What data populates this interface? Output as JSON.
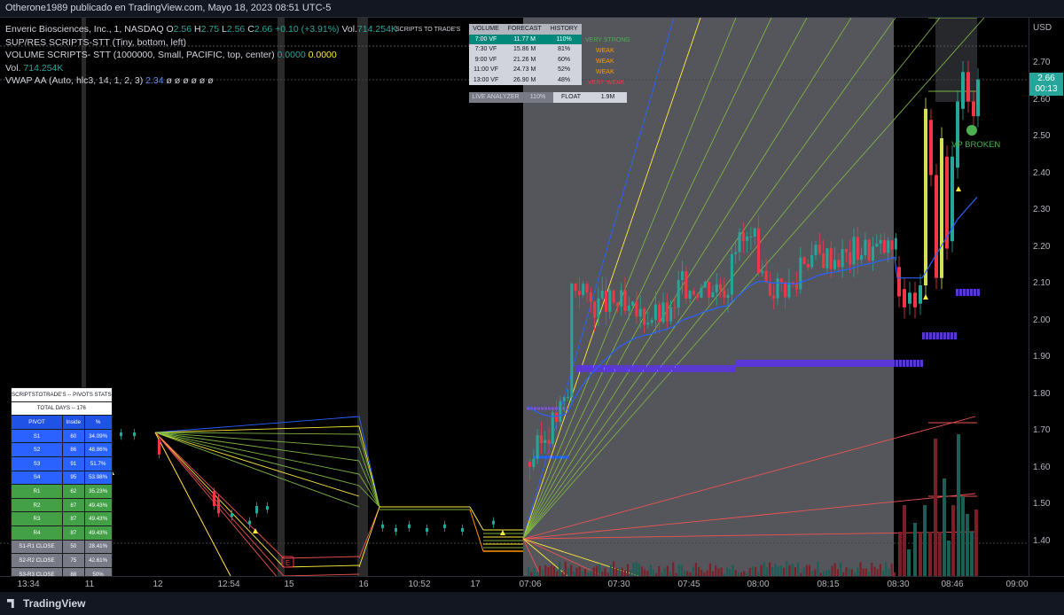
{
  "header": {
    "published": "Otherone1989 publicado en TradingView.com, Mayo 18, 2023 08:51 UTC-5"
  },
  "legend": {
    "symbol_line": "Enveric Biosciences, Inc., 1, NASDAQ",
    "o_label": "O",
    "o": "2.56",
    "h_label": "H",
    "h": "2.75",
    "l_label": "L",
    "l": "2.56",
    "c_label": "C",
    "c": "2.66",
    "change": "+0.10 (+3.91%)",
    "vol_label": "Vol.",
    "vol": "714.254K",
    "sup_res": "SUP/RES SCRIPTS-STT (Tiny, bottom, left)",
    "vol_scripts": "VOLUME SCRIPTS- STT (1000000, Small, PACIFIC, top, center)",
    "vol_scripts_v1": "0.0000",
    "vol_scripts_v2": "0.0000",
    "vol2_label": "Vol.",
    "vol2": "714.254K",
    "vwap": "VWAP AA (Auto, hlc3, 14, 1, 2, 3)",
    "vwap_value": "2.34",
    "vwap_rest": "ø ø ø ø ø ø"
  },
  "volume_table": {
    "title": "SCRIPTS TO TRADE'S",
    "headers": [
      "VOLUME",
      "FORECAST",
      "HISTORY"
    ],
    "rows": [
      {
        "time": "7:00 VF",
        "forecast": "11.77 M",
        "history": "110%",
        "status": "VERY STRONG",
        "status_color": "#4caf50",
        "highlight": true
      },
      {
        "time": "7:30 VF",
        "forecast": "15.86 M",
        "history": "81%",
        "status": "WEAK",
        "status_color": "#ff9800",
        "highlight": false
      },
      {
        "time": "9:00 VF",
        "forecast": "21.26 M",
        "history": "60%",
        "status": "WEAK",
        "status_color": "#ff9800",
        "highlight": false
      },
      {
        "time": "11:00 VF",
        "forecast": "24.73 M",
        "history": "52%",
        "status": "WEAK",
        "status_color": "#ff9800",
        "highlight": false
      },
      {
        "time": "13:00 VF",
        "forecast": "26.90 M",
        "history": "48%",
        "status": "VERY WEAK",
        "status_color": "#f23645",
        "highlight": false
      }
    ],
    "live_label": "LIVE ANALYZER",
    "live_value": "110%",
    "float_label": "FLOAT",
    "float_value": "1.9M"
  },
  "pivot_table": {
    "title": "SCRIPTSTOTRADE'S -- PIVOTS STATS",
    "total_days": "TOTAL DAYS -- 176",
    "headers": [
      "PIVOT",
      "Inside",
      "%"
    ],
    "rows": [
      {
        "pivot": "S1",
        "inside": "60",
        "pct": "34.09%",
        "color": "#2962ff"
      },
      {
        "pivot": "S2",
        "inside": "86",
        "pct": "48.86%",
        "color": "#2962ff"
      },
      {
        "pivot": "S3",
        "inside": "91",
        "pct": "51.7%",
        "color": "#2962ff"
      },
      {
        "pivot": "S4",
        "inside": "95",
        "pct": "53.98%",
        "color": "#2962ff"
      },
      {
        "pivot": "R1",
        "inside": "62",
        "pct": "35.23%",
        "color": "#43a047"
      },
      {
        "pivot": "R2",
        "inside": "87",
        "pct": "49.43%",
        "color": "#43a047"
      },
      {
        "pivot": "R3",
        "inside": "87",
        "pct": "49.43%",
        "color": "#43a047"
      },
      {
        "pivot": "R4",
        "inside": "87",
        "pct": "49.43%",
        "color": "#43a047"
      },
      {
        "pivot": "S1-R1 CLOSE",
        "inside": "50",
        "pct": "28.41%",
        "color": "#787b86"
      },
      {
        "pivot": "S2-R2 CLOSE",
        "inside": "75",
        "pct": "42.61%",
        "color": "#787b86"
      },
      {
        "pivot": "S3-R3 CLOSE",
        "inside": "88",
        "pct": "50%",
        "color": "#787b86"
      },
      {
        "pivot": "S4-R4 CLOSE",
        "inside": "92",
        "pct": "52.27%",
        "color": "#787b86"
      }
    ]
  },
  "annotation": {
    "vp_broken": "VP BROKEN",
    "earnings_marker": "E"
  },
  "price_scale": {
    "currency": "USD",
    "ticks": [
      "2.70",
      "2.60",
      "2.50",
      "2.40",
      "2.30",
      "2.20",
      "2.10",
      "2.00",
      "1.90",
      "1.80",
      "1.70",
      "1.60",
      "1.50",
      "1.40"
    ],
    "current_price": "2.66",
    "countdown": "00:13"
  },
  "time_axis": {
    "labels": [
      "13:34",
      "11",
      "12",
      "12:54",
      "15",
      "16",
      "10:52",
      "17",
      "07:06",
      "07:30",
      "07:45",
      "08:00",
      "08:15",
      "08:30",
      "08:46",
      "09:00"
    ]
  },
  "footer": {
    "brand": "TradingView"
  },
  "colors": {
    "up": "#26a69a",
    "down": "#f23645",
    "premarket_bg": "#55565c",
    "vwap": "#2962ff",
    "pivot_band": "#5c35d6"
  }
}
